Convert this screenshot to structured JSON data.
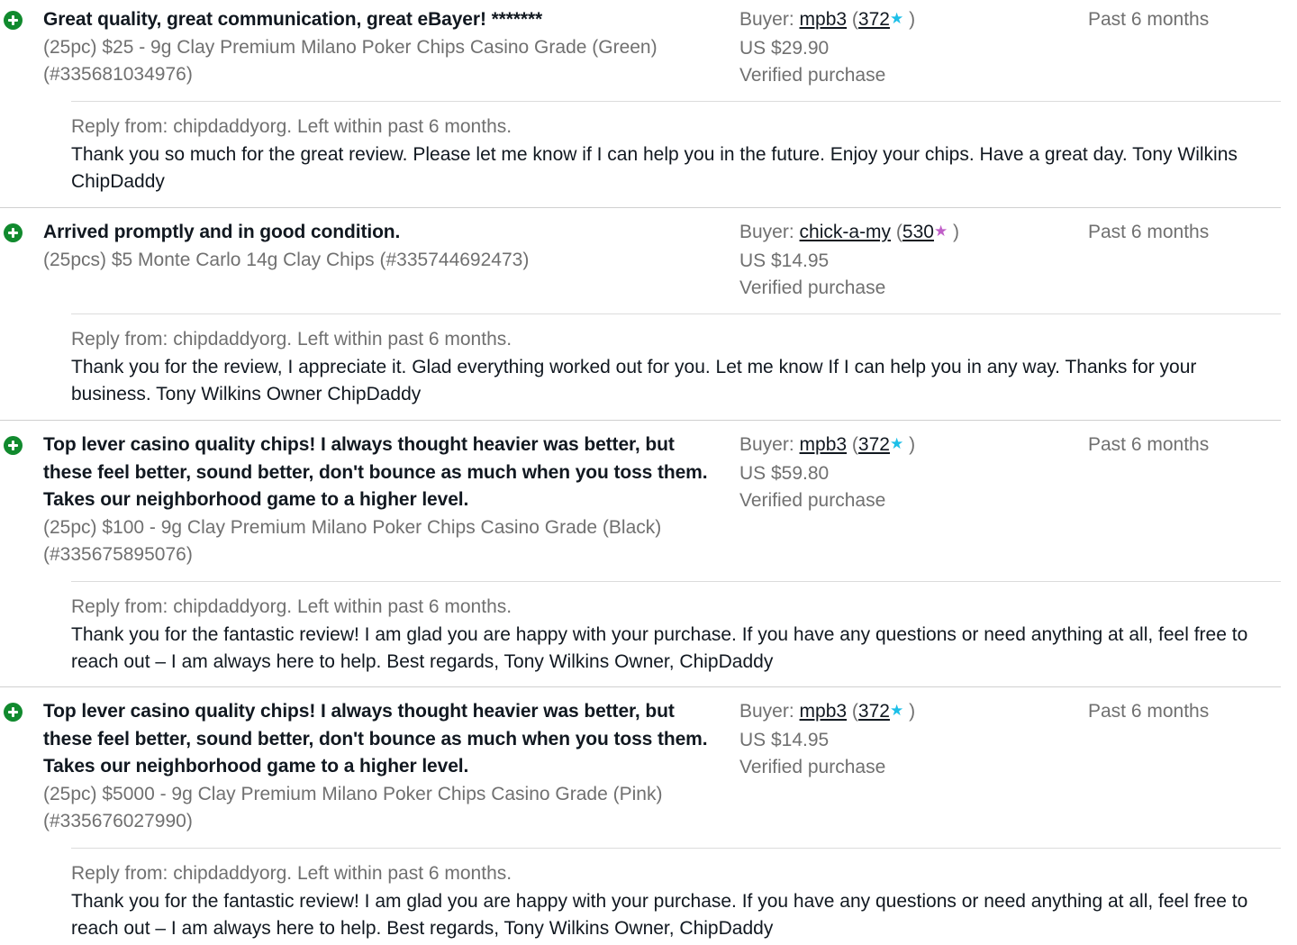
{
  "colors": {
    "positive_icon": "#118a2e",
    "star_turquoise": "#1cbfe8",
    "star_purple": "#c05fc8",
    "muted_text": "#707070",
    "primary_text": "#111820"
  },
  "labels": {
    "buyer_prefix": "Buyer:",
    "open_paren": "(",
    "close_paren": ")",
    "star_glyph": "★",
    "verified": "Verified purchase"
  },
  "entries": [
    {
      "rating_icon": "positive-feedback-icon",
      "comment": "Great quality, great communication, great eBayer! *******",
      "item": "(25pc) $25 - 9g Clay Premium Milano Poker Chips Casino Grade (Green) (#335681034976)",
      "buyer": "mpb3",
      "score": "372",
      "star_color": "#1cbfe8",
      "price": "US $29.90",
      "time": "Past 6 months",
      "reply_header": "Reply from: chipdaddyorg. Left within past 6 months.",
      "reply_text": "Thank you so much for the great review. Please let me know if I can help you in the future. Enjoy your chips. Have a great day. Tony Wilkins ChipDaddy"
    },
    {
      "rating_icon": "positive-feedback-icon",
      "comment": "Arrived promptly and in good condition.",
      "item": "(25pcs) $5 Monte Carlo 14g Clay Chips (#335744692473)",
      "buyer": "chick-a-my",
      "score": "530",
      "star_color": "#c05fc8",
      "price": "US $14.95",
      "time": "Past 6 months",
      "reply_header": "Reply from: chipdaddyorg. Left within past 6 months.",
      "reply_text": "Thank you for the review, I appreciate it. Glad everything worked out for you. Let me know If I can help you in any way. Thanks for your business. Tony Wilkins Owner ChipDaddy"
    },
    {
      "rating_icon": "positive-feedback-icon",
      "comment": "Top lever casino quality chips! I always thought heavier was better, but these feel better, sound better, don't bounce as much when you toss them. Takes our neighborhood game to a higher level.",
      "item": "(25pc) $100 - 9g Clay Premium Milano Poker Chips Casino Grade (Black) (#335675895076)",
      "buyer": "mpb3",
      "score": "372",
      "star_color": "#1cbfe8",
      "price": "US $59.80",
      "time": "Past 6 months",
      "reply_header": "Reply from: chipdaddyorg. Left within past 6 months.",
      "reply_text": "Thank you for the fantastic review! I am glad you are happy with your purchase. If you have any questions or need anything at all, feel free to reach out – I am always here to help. Best regards, Tony Wilkins Owner, ChipDaddy"
    },
    {
      "rating_icon": "positive-feedback-icon",
      "comment": "Top lever casino quality chips! I always thought heavier was better, but these feel better, sound better, don't bounce as much when you toss them. Takes our neighborhood game to a higher level.",
      "item": "(25pc) $5000 - 9g Clay Premium Milano Poker Chips Casino Grade (Pink) (#335676027990)",
      "buyer": "mpb3",
      "score": "372",
      "star_color": "#1cbfe8",
      "price": "US $14.95",
      "time": "Past 6 months",
      "reply_header": "Reply from: chipdaddyorg. Left within past 6 months.",
      "reply_text": "Thank you for the fantastic review! I am glad you are happy with your purchase. If you have any questions or need anything at all, feel free to reach out – I am always here to help. Best regards, Tony Wilkins Owner, ChipDaddy"
    }
  ]
}
